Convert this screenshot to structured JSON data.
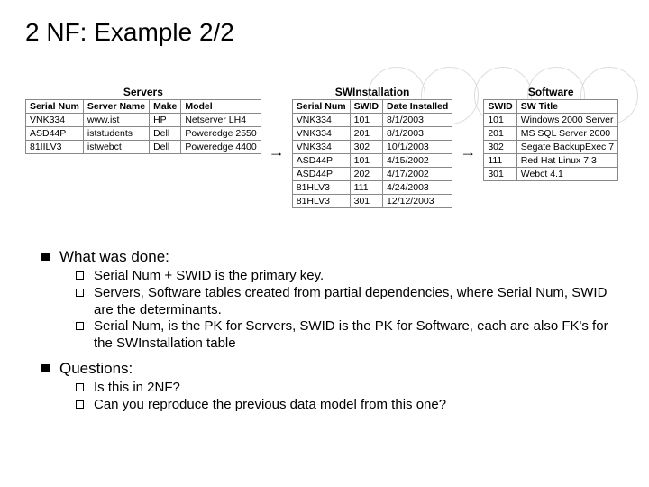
{
  "title": "2 NF: Example 2/2",
  "tables": {
    "servers": {
      "title": "Servers",
      "headers": [
        "Serial Num",
        "Server Name",
        "Make",
        "Model"
      ],
      "rows": [
        [
          "VNK334",
          "www.ist",
          "HP",
          "Netserver LH4"
        ],
        [
          "ASD44P",
          "iststudents",
          "Dell",
          "Poweredge 2550"
        ],
        [
          "81IILV3",
          "istwebct",
          "Dell",
          "Poweredge 4400"
        ]
      ]
    },
    "swinstall": {
      "title": "SWInstallation",
      "headers": [
        "Serial Num",
        "SWID",
        "Date Installed"
      ],
      "rows": [
        [
          "VNK334",
          "101",
          "8/1/2003"
        ],
        [
          "VNK334",
          "201",
          "8/1/2003"
        ],
        [
          "VNK334",
          "302",
          "10/1/2003"
        ],
        [
          "ASD44P",
          "101",
          "4/15/2002"
        ],
        [
          "ASD44P",
          "202",
          "4/17/2002"
        ],
        [
          "81HLV3",
          "111",
          "4/24/2003"
        ],
        [
          "81HLV3",
          "301",
          "12/12/2003"
        ]
      ]
    },
    "software": {
      "title": "Software",
      "headers": [
        "SWID",
        "SW Title"
      ],
      "rows": [
        [
          "101",
          "Windows 2000 Server"
        ],
        [
          "201",
          "MS SQL Server 2000"
        ],
        [
          "302",
          "Segate BackupExec 7"
        ],
        [
          "111",
          "Red Hat Linux 7.3"
        ],
        [
          "301",
          "Webct 4.1"
        ]
      ]
    }
  },
  "bullets": {
    "what_title": "What was done:",
    "what": [
      "Serial Num + SWID is the primary key.",
      "Servers, Software tables created from partial dependencies, where Serial Num, SWID are the determinants.",
      "Serial Num, is the PK for Servers, SWID is the PK for Software, each are also FK's for the SWInstallation table"
    ],
    "q_title": "Questions:",
    "q": [
      "Is this in 2NF?",
      "Can you reproduce the previous data model from this one?"
    ]
  }
}
